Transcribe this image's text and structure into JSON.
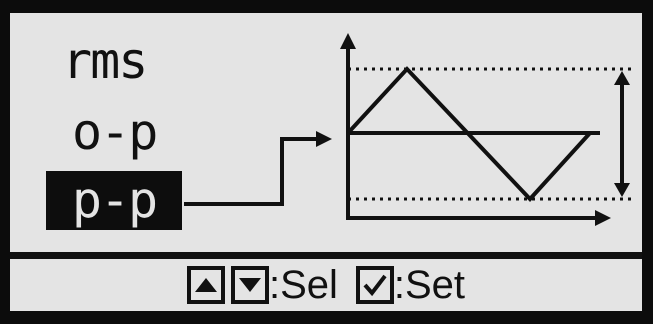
{
  "options": [
    {
      "label": "rms",
      "selected": false
    },
    {
      "label": "o-p",
      "selected": false
    },
    {
      "label": "p-p",
      "selected": true
    }
  ],
  "footer": {
    "up_key_icon": "up-triangle-icon",
    "down_key_icon": "down-triangle-icon",
    "select_label": ":Sel",
    "check_key_icon": "checkmark-icon",
    "set_label": ":Set"
  },
  "colors": {
    "screen_bg": "#e4e4e4",
    "ink": "#111111",
    "bezel": "#0c0c0c"
  }
}
